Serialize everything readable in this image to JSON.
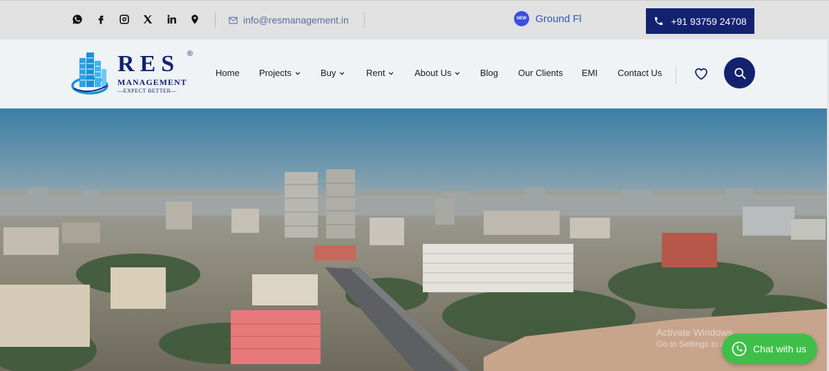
{
  "topbar": {
    "social_icons": [
      "whatsapp-icon",
      "facebook-icon",
      "instagram-icon",
      "x-icon",
      "linkedin-icon",
      "location-pin-icon"
    ],
    "email": "info@resmanagement.in",
    "ticker_badge": "NEW",
    "ticker_text": "Ground Fl",
    "phone": "+91 93759 24708"
  },
  "logo": {
    "title": "RES",
    "subtitle": "MANAGEMENT",
    "tagline": "—EXPECT BETTER—",
    "registered": "®"
  },
  "nav": {
    "items": [
      {
        "label": "Home",
        "dropdown": false
      },
      {
        "label": "Projects",
        "dropdown": true
      },
      {
        "label": "Buy",
        "dropdown": true
      },
      {
        "label": "Rent",
        "dropdown": true
      },
      {
        "label": "About Us",
        "dropdown": true
      },
      {
        "label": "Blog",
        "dropdown": false
      },
      {
        "label": "Our Clients",
        "dropdown": false
      },
      {
        "label": "EMI",
        "dropdown": false
      },
      {
        "label": "Contact Us",
        "dropdown": false
      }
    ]
  },
  "hero": {
    "watermark_title": "Activate Windows",
    "watermark_sub": "Go to Settings to activate Windows."
  },
  "chat": {
    "label": "Chat with us"
  },
  "colors": {
    "brand_navy": "#13226f",
    "topbar_bg": "#e1e1e1",
    "header_bg": "#eff3f6",
    "chat_green": "#3fbf4a",
    "email_text": "#5a6ea0"
  }
}
